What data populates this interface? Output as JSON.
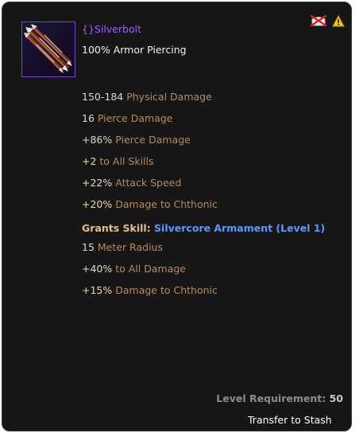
{
  "item": {
    "name": "{}Silverbolt",
    "subtitle": "100% Armor Piercing",
    "icon": "crossbow-bolts-icon"
  },
  "status_icons": [
    "crossed-out-chest-icon",
    "warning-icon"
  ],
  "stats": [
    {
      "value": "150-184",
      "label": " Physical Damage"
    },
    {
      "value": "16",
      "label": " Pierce Damage"
    },
    {
      "value": "+86%",
      "label": " Pierce Damage"
    },
    {
      "value": "+2",
      "label": " to All Skills"
    },
    {
      "value": "+22%",
      "label": " Attack Speed"
    },
    {
      "value": "+20%",
      "label": " Damage to Chthonic"
    }
  ],
  "granted_skill": {
    "label": "Grants Skill: ",
    "name": "Silvercore Armament (Level 1)"
  },
  "skill_stats": [
    {
      "value": "15",
      "label": " Meter Radius"
    },
    {
      "value": "+40%",
      "label": " to All Damage"
    },
    {
      "value": "+15%",
      "label": " Damage to Chthonic"
    }
  ],
  "requirement": {
    "label": "Level Requirement: ",
    "value": "50"
  },
  "actions": {
    "transfer_label": "Transfer to Stash"
  },
  "colors": {
    "background": "#161616",
    "item_name": "#a25cff",
    "stat_value": "#ead7bd",
    "stat_label": "#b58b60",
    "skill_name": "#5e98ff"
  }
}
